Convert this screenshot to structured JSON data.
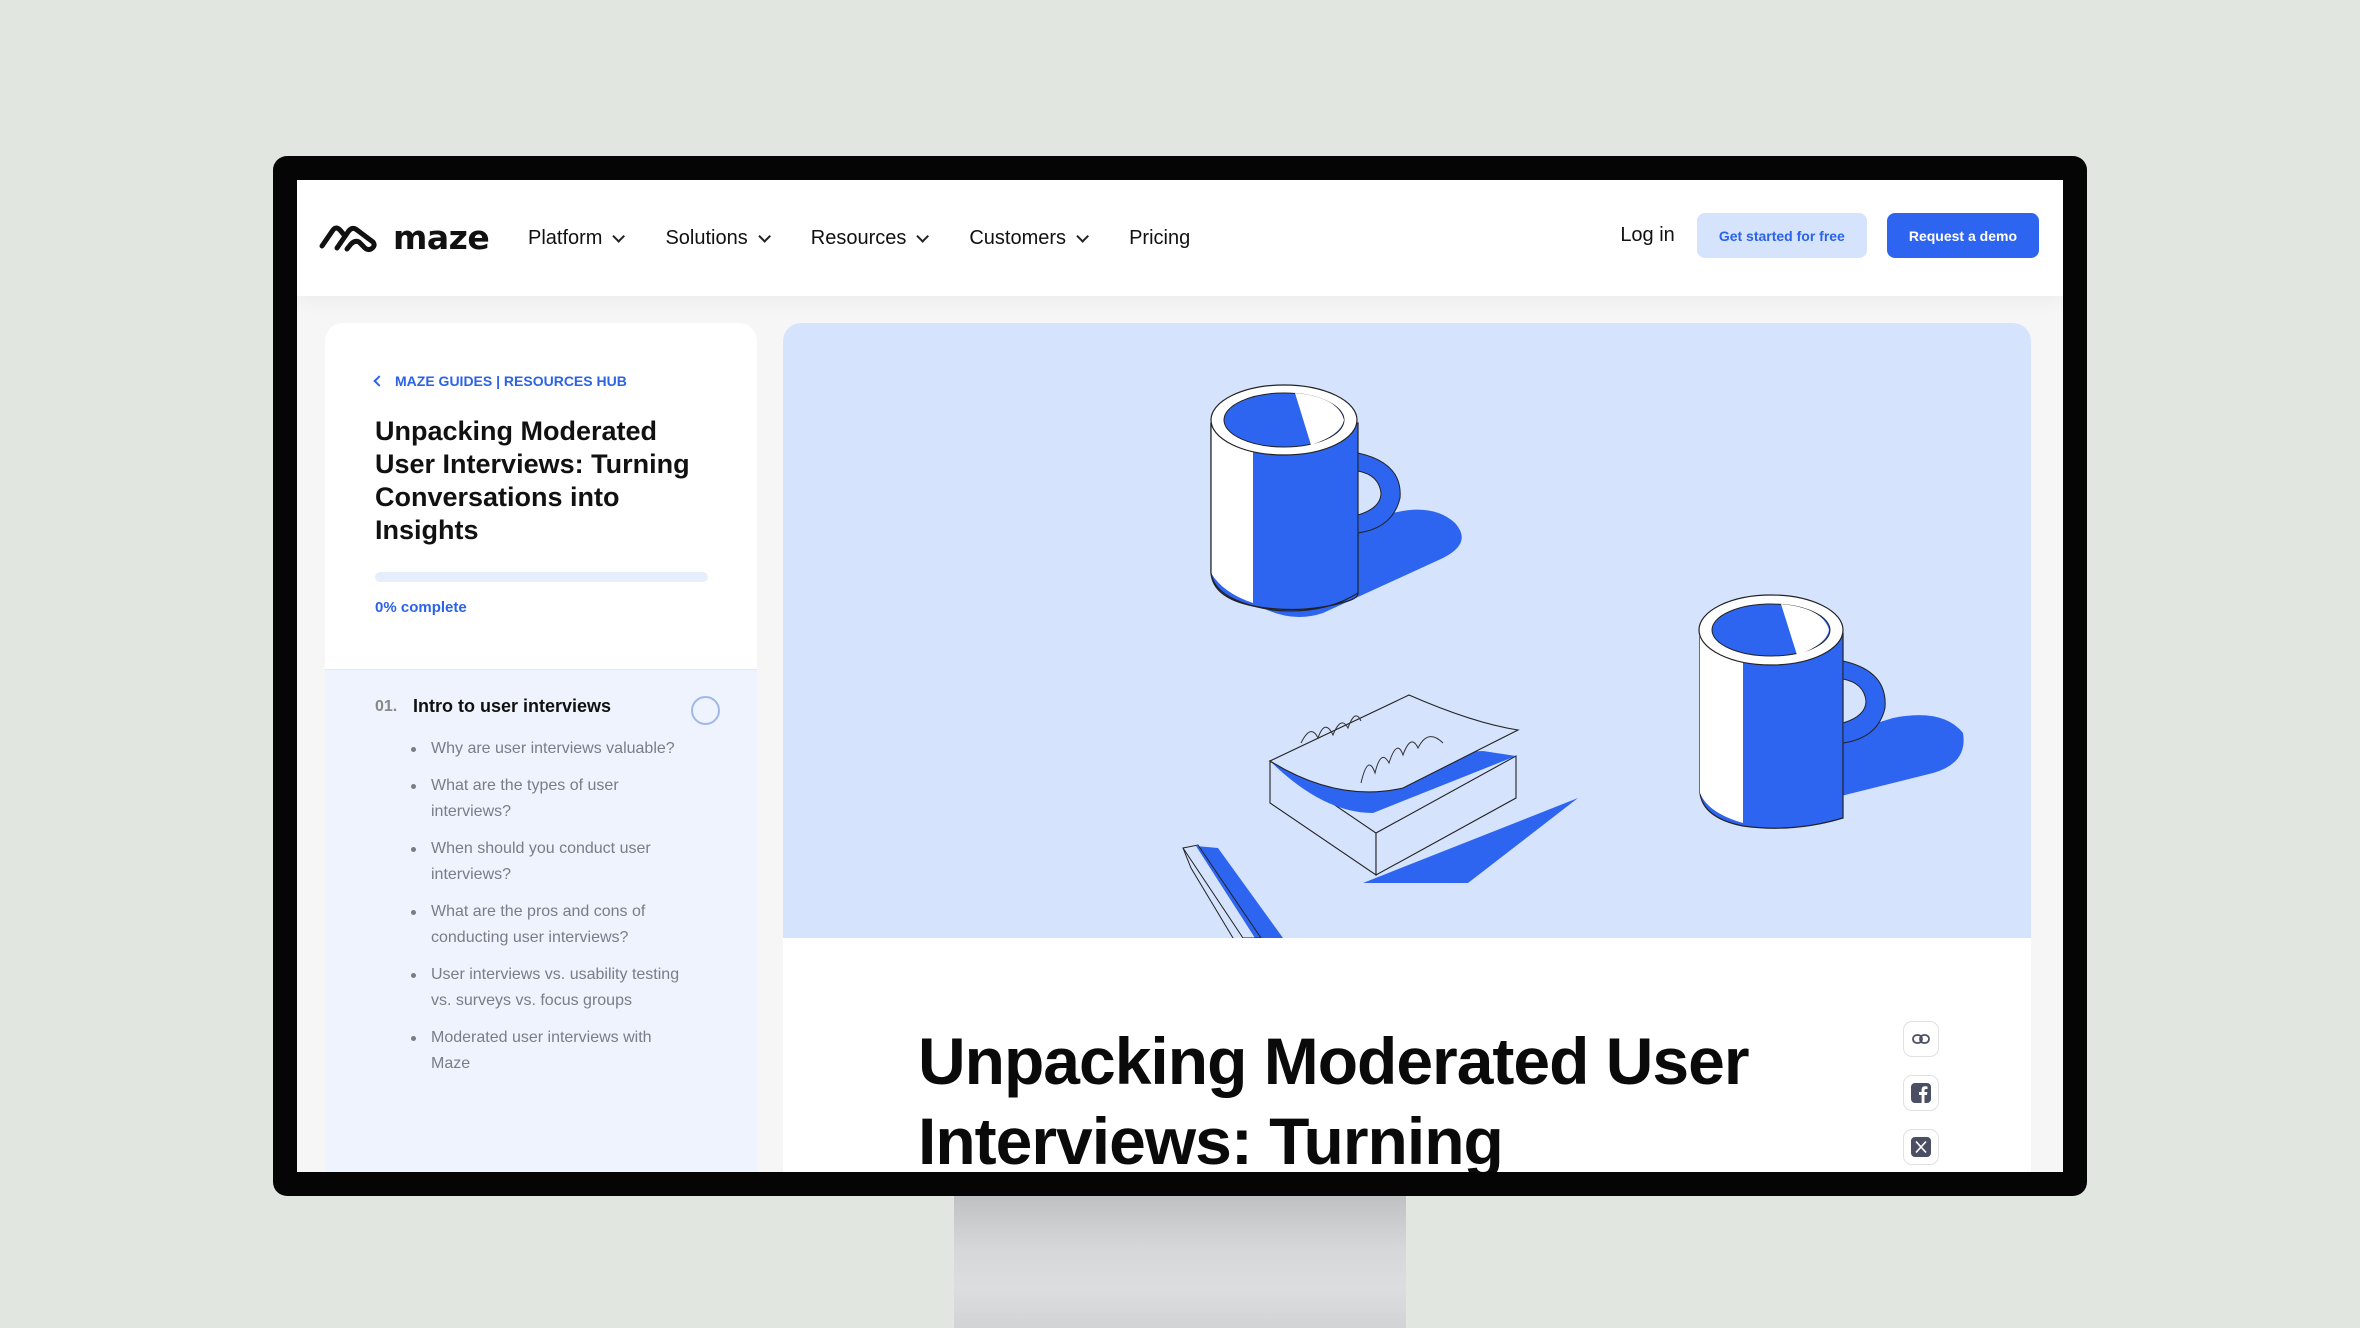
{
  "nav": {
    "brand": "maze",
    "menu": [
      {
        "label": "Platform",
        "has_dropdown": true
      },
      {
        "label": "Solutions",
        "has_dropdown": true
      },
      {
        "label": "Resources",
        "has_dropdown": true
      },
      {
        "label": "Customers",
        "has_dropdown": true
      },
      {
        "label": "Pricing",
        "has_dropdown": false
      }
    ],
    "login_label": "Log in",
    "get_started_label": "Get started for free",
    "demo_label": "Request a demo"
  },
  "sidebar": {
    "breadcrumb": "MAZE GUIDES | RESOURCES HUB",
    "title": "Unpacking Moderated User Interviews: Turning Conversations into Insights",
    "progress_percent": 0,
    "progress_label": "0% complete",
    "chapter": {
      "number": "01.",
      "title": "Intro to user interviews",
      "items": [
        "Why are user interviews valuable?",
        "What are the types of user interviews?",
        "When should you conduct user interviews?",
        "What are the pros and cons of conducting user interviews?",
        "User interviews vs. usability testing vs. surveys vs. focus groups",
        "Moderated user interviews with Maze"
      ]
    }
  },
  "article": {
    "title": "Unpacking Moderated User Interviews: Turning Conversations into Insights",
    "share_icons": [
      "link-icon",
      "facebook-icon",
      "x-icon"
    ]
  },
  "colors": {
    "accent": "#2e65f0",
    "accent_light": "#d5e3fd",
    "hero_bg": "#d5e3fd",
    "toc_bg": "#eef3fe"
  }
}
